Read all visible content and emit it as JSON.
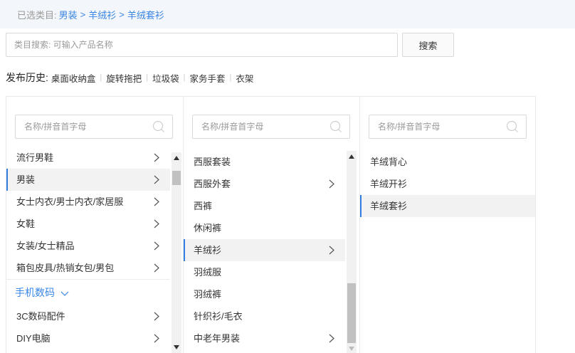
{
  "selected_path": {
    "prefix": "已选类目:",
    "levels": [
      "男装",
      "羊绒衫",
      "羊绒套衫"
    ],
    "separator": ">"
  },
  "search": {
    "placeholder": "类目搜索: 可输入产品名称",
    "value": "",
    "button_label": "搜索"
  },
  "history": {
    "label": "发布历史:",
    "items": [
      "桌面收纳盒",
      "旋转拖把",
      "垃圾袋",
      "家务手套",
      "衣架"
    ]
  },
  "panel1": {
    "filter_placeholder": "名称/拼音首字母",
    "items": [
      {
        "label": "流行男鞋",
        "has_children": true,
        "selected": false
      },
      {
        "label": "男装",
        "has_children": true,
        "selected": true
      },
      {
        "label": "女士内衣/男士内衣/家居服",
        "has_children": true,
        "selected": false
      },
      {
        "label": "女鞋",
        "has_children": true,
        "selected": false
      },
      {
        "label": "女装/女士精品",
        "has_children": true,
        "selected": false
      },
      {
        "label": "箱包皮具/热销女包/男包",
        "has_children": true,
        "selected": false
      }
    ],
    "group_label": "手机数码",
    "group_items": [
      {
        "label": "3C数码配件",
        "has_children": true,
        "selected": false
      },
      {
        "label": "DIY电脑",
        "has_children": true,
        "selected": false
      }
    ]
  },
  "panel2": {
    "filter_placeholder": "名称/拼音首字母",
    "items": [
      {
        "label": "西服套装",
        "has_children": false,
        "selected": false
      },
      {
        "label": "西服外套",
        "has_children": true,
        "selected": false
      },
      {
        "label": "西裤",
        "has_children": false,
        "selected": false
      },
      {
        "label": "休闲裤",
        "has_children": false,
        "selected": false
      },
      {
        "label": "羊绒衫",
        "has_children": true,
        "selected": true
      },
      {
        "label": "羽绒服",
        "has_children": false,
        "selected": false
      },
      {
        "label": "羽绒裤",
        "has_children": false,
        "selected": false
      },
      {
        "label": "针织衫/毛衣",
        "has_children": false,
        "selected": false
      },
      {
        "label": "中老年男装",
        "has_children": true,
        "selected": false
      }
    ]
  },
  "panel3": {
    "filter_placeholder": "名称/拼音首字母",
    "items": [
      {
        "label": "羊绒背心",
        "has_children": false,
        "selected": false
      },
      {
        "label": "羊绒开衫",
        "has_children": false,
        "selected": false
      },
      {
        "label": "羊绒套衫",
        "has_children": false,
        "selected": true
      }
    ]
  },
  "colors": {
    "accent": "#3a86e5",
    "selected_bg": "#f2f2f2",
    "selected_bar": "#2f7ee0"
  },
  "icons": {
    "filter": "search-icon",
    "expand": "chevron-right-icon",
    "group": "chevron-down-icon"
  }
}
